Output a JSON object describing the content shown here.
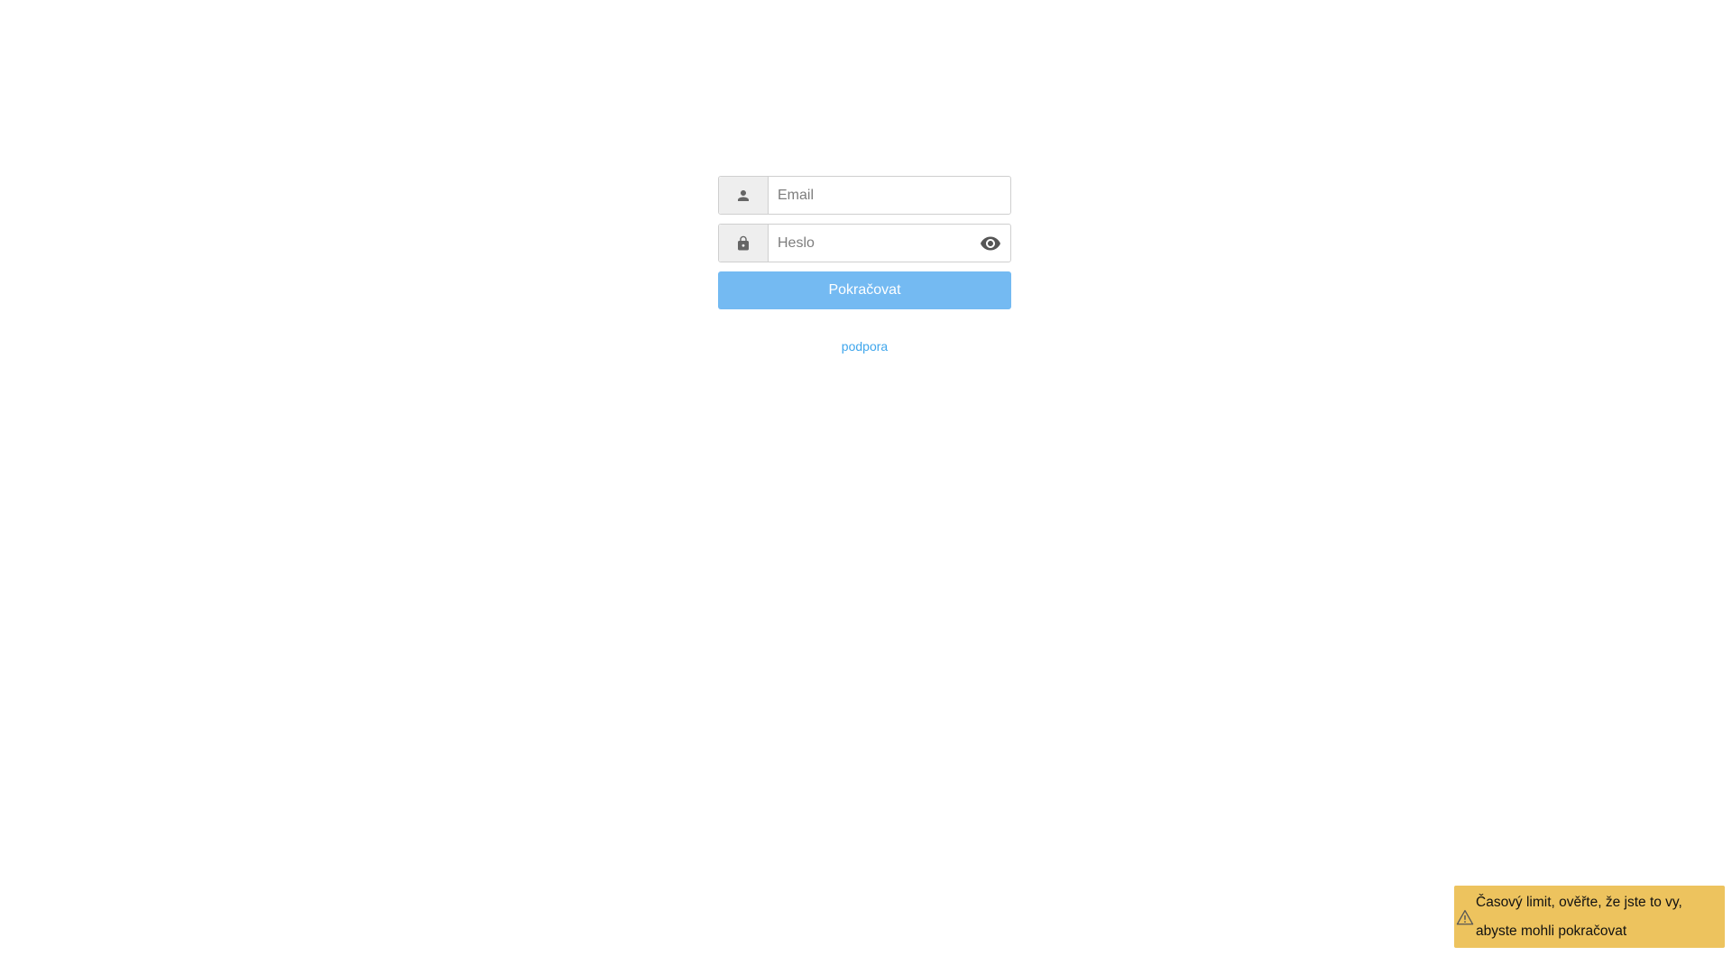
{
  "login": {
    "email": {
      "icon": "person-icon",
      "placeholder": "Email",
      "value": ""
    },
    "password": {
      "icon": "lock-icon",
      "placeholder": "Heslo",
      "value": "",
      "toggle_icon": "eye-icon"
    },
    "submit_label": "Pokračovat",
    "support_label": "podpora"
  },
  "toast": {
    "icon": "warning-icon",
    "message": "Časový limit, ověřte, že jste to vy, abyste mohli pokračovat",
    "color": "#edc35e"
  },
  "colors": {
    "button": "#74baf2",
    "link": "#3fa6ec"
  }
}
